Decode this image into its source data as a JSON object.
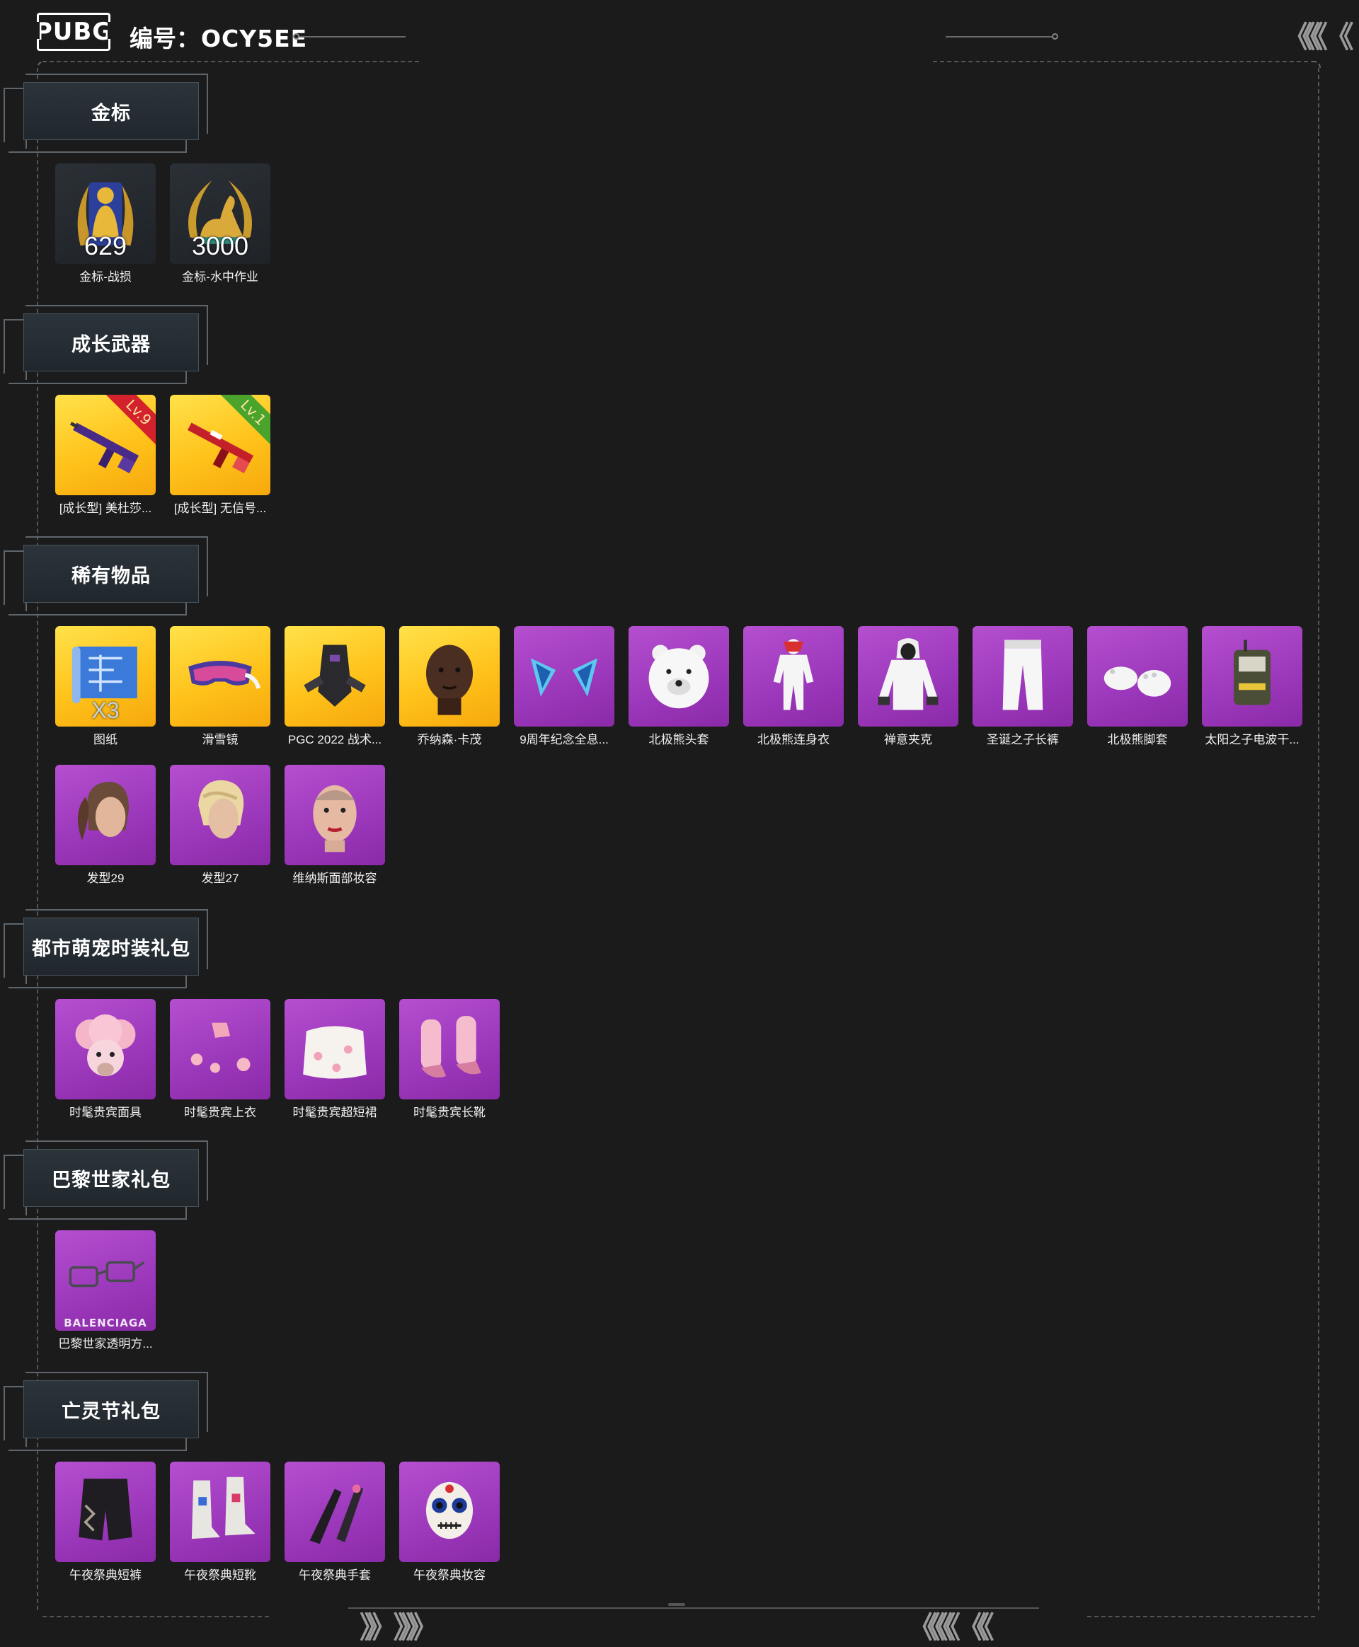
{
  "header": {
    "logo_text": "PUBG",
    "account_prefix": "编号：",
    "account_code": "OCY5EE",
    "nav_arrows_top": "《《《 《",
    "nav_arrows_bottom_left": "》》 》》》",
    "nav_arrows_bottom_right": "《《《《 《《"
  },
  "sections": [
    {
      "title": "金标",
      "items": [
        {
          "label": "金标-战损",
          "qty": "629",
          "style": "dark",
          "icon": "gold-soldier-badge-icon"
        },
        {
          "label": "金标-水中作业",
          "qty": "3000",
          "style": "dark",
          "icon": "gold-seal-badge-icon"
        }
      ]
    },
    {
      "title": "成长武器",
      "items": [
        {
          "label": "[成长型] 美杜莎...",
          "level": "Lv.9",
          "level_color": "#d3222c",
          "style": "gold",
          "icon": "purple-rifle-icon"
        },
        {
          "label": "[成长型] 无信号...",
          "level": "Lv.1",
          "level_color": "#4aa42b",
          "style": "gold",
          "icon": "red-rifle-icon"
        }
      ]
    },
    {
      "title": "稀有物品",
      "items": [
        {
          "label": "图纸",
          "qty": "X3",
          "style": "gold",
          "icon": "blueprint-icon"
        },
        {
          "label": "滑雪镜",
          "style": "gold",
          "icon": "ski-goggles-icon"
        },
        {
          "label": "PGC 2022 战术...",
          "style": "gold",
          "icon": "tactical-gear-icon"
        },
        {
          "label": "乔纳森·卡茂",
          "style": "gold",
          "icon": "character-head-icon"
        },
        {
          "label": "9周年纪念全息...",
          "style": "purple",
          "icon": "holo-ears-icon"
        },
        {
          "label": "北极熊头套",
          "style": "purple",
          "icon": "polar-bear-head-icon"
        },
        {
          "label": "北极熊连身衣",
          "style": "purple",
          "icon": "bear-suit-icon"
        },
        {
          "label": "禅意夹克",
          "style": "purple",
          "icon": "hooded-jacket-icon"
        },
        {
          "label": "圣诞之子长裤",
          "style": "purple",
          "icon": "white-pants-icon"
        },
        {
          "label": "北极熊脚套",
          "style": "purple",
          "icon": "bear-paws-icon"
        },
        {
          "label": "太阳之子电波干...",
          "style": "purple",
          "icon": "backpack-device-icon"
        },
        {
          "label": "发型29",
          "style": "purple",
          "icon": "hairstyle-ponytail-icon"
        },
        {
          "label": "发型27",
          "style": "purple",
          "icon": "hairstyle-blonde-icon"
        },
        {
          "label": "维纳斯面部妆容",
          "style": "purple",
          "icon": "face-makeup-icon"
        }
      ]
    },
    {
      "title": "都市萌宠时装礼包",
      "items": [
        {
          "label": "时髦贵宾面具",
          "style": "purple",
          "icon": "poodle-mask-icon"
        },
        {
          "label": "时髦贵宾上衣",
          "style": "purple",
          "icon": "pink-top-icon"
        },
        {
          "label": "时髦贵宾超短裙",
          "style": "purple",
          "icon": "fluffy-skirt-icon"
        },
        {
          "label": "时髦贵宾长靴",
          "style": "purple",
          "icon": "pink-boots-icon"
        }
      ]
    },
    {
      "title": "巴黎世家礼包",
      "items": [
        {
          "label": "巴黎世家透明方...",
          "brand": "BALENCIAGA",
          "style": "purple",
          "icon": "clear-glasses-icon"
        }
      ]
    },
    {
      "title": "亡灵节礼包",
      "items": [
        {
          "label": "午夜祭典短裤",
          "style": "purple",
          "icon": "black-shorts-icon"
        },
        {
          "label": "午夜祭典短靴",
          "style": "purple",
          "icon": "white-boots-icon"
        },
        {
          "label": "午夜祭典手套",
          "style": "purple",
          "icon": "black-gloves-icon"
        },
        {
          "label": "午夜祭典妆容",
          "style": "purple",
          "icon": "skull-makeup-icon"
        }
      ]
    }
  ]
}
